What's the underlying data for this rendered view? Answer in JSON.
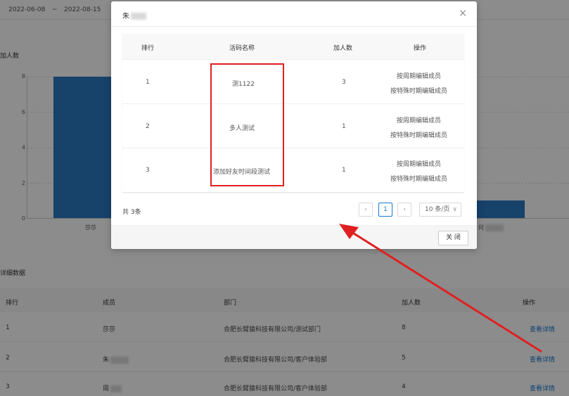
{
  "background": {
    "date_start": "2022-06-08",
    "date_sep": "~",
    "date_end": "2022-08-15",
    "chart_section_title": "加人数",
    "detail_section_title": "详细数据",
    "table_headers": [
      "排行",
      "成员",
      "部门",
      "加人数",
      "操作"
    ],
    "rows": [
      {
        "rank": "1",
        "member": "莎莎",
        "dept": "合肥长臂猿科技有限公司/测试部门",
        "count": "8",
        "action": "查看详情"
      },
      {
        "rank": "2",
        "member": "朱",
        "dept": "合肥长臂猿科技有限公司/客户体验部",
        "count": "5",
        "action": "查看详情"
      },
      {
        "rank": "3",
        "member": "周",
        "dept": "合肥长臂猿科技有限公司/客户体验部",
        "count": "4",
        "action": "查看详情"
      }
    ]
  },
  "chart_data": {
    "type": "bar",
    "title": "加人数",
    "categories": [
      "莎莎",
      "何"
    ],
    "values": [
      8,
      1
    ],
    "yticks": [
      "0",
      "2",
      "4",
      "6",
      "8"
    ],
    "ylim": [
      0,
      8
    ],
    "bar_color": "#2b78c2"
  },
  "modal": {
    "title": "朱",
    "close_icon": "close-icon",
    "headers": [
      "排行",
      "活码名称",
      "加人数",
      "操作"
    ],
    "rows": [
      {
        "rank": "1",
        "name": "测1122",
        "count": "3",
        "op1": "按周期编辑成员",
        "op2": "按特殊时期编辑成员"
      },
      {
        "rank": "2",
        "name": "多人测试",
        "count": "1",
        "op1": "按周期编辑成员",
        "op2": "按特殊时期编辑成员"
      },
      {
        "rank": "3",
        "name": "添加好友时间段测试",
        "count": "1",
        "op1": "按周期编辑成员",
        "op2": "按特殊时期编辑成员"
      }
    ],
    "total": "共 3条",
    "prev": "‹",
    "page": "1",
    "next": "›",
    "page_size": "10 条/页",
    "page_size_chevron": "∨",
    "close_button": "关 闭"
  },
  "colors": {
    "link": "#1779d1",
    "highlight": "#e02020"
  }
}
